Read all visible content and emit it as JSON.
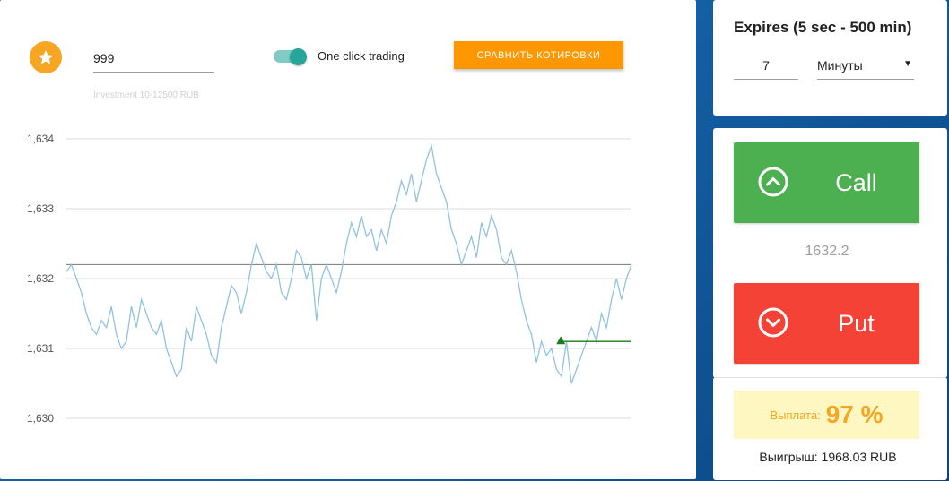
{
  "controls": {
    "investment_value": "999",
    "investment_hint": "Investment 10-12500 RUB",
    "one_click_label": "One click trading",
    "one_click_enabled": true,
    "compare_button_label": "СРАВНИТЬ КОТИРОВКИ"
  },
  "expires": {
    "title": "Expires (5 sec - 500 min)",
    "value": "7",
    "unit": "Минуты"
  },
  "trade": {
    "call_label": "Call",
    "put_label": "Put",
    "current_price": "1632.2"
  },
  "payout": {
    "label": "Выплата:",
    "value": "97 %",
    "win_text": "Выигрыш: 1968.03 RUB"
  },
  "colors": {
    "accent_orange": "#ff9800",
    "call_green": "#4caf50",
    "put_red": "#f44336",
    "toggle_teal": "#26a69a",
    "price_line": "#90c2e2",
    "entry_marker": "#1b7a1b",
    "payout_gold": "#f5a623"
  },
  "chart_data": {
    "type": "line",
    "y_ticks": [
      "1,634",
      "1,633",
      "1,632",
      "1,631",
      "1,630"
    ],
    "ylim": [
      1.63,
      1.634
    ],
    "reference_level": 1.6322,
    "entry_level": 1.6311,
    "entry_marker_x": 0.875,
    "series": [
      {
        "values": [
          1.6321,
          1.6322,
          1.632,
          1.6318,
          1.6315,
          1.6313,
          1.6312,
          1.6314,
          1.6313,
          1.6316,
          1.6312,
          1.631,
          1.6311,
          1.6316,
          1.6313,
          1.6317,
          1.6315,
          1.6313,
          1.6312,
          1.6314,
          1.631,
          1.6308,
          1.6306,
          1.6307,
          1.6313,
          1.6311,
          1.6316,
          1.6314,
          1.6312,
          1.6309,
          1.6308,
          1.6313,
          1.6316,
          1.6319,
          1.6318,
          1.6315,
          1.6318,
          1.6322,
          1.6325,
          1.6323,
          1.6321,
          1.632,
          1.6322,
          1.6318,
          1.6317,
          1.632,
          1.6324,
          1.6323,
          1.632,
          1.6322,
          1.6314,
          1.632,
          1.6322,
          1.632,
          1.6318,
          1.6321,
          1.6325,
          1.6328,
          1.6326,
          1.6329,
          1.6326,
          1.6327,
          1.6324,
          1.6327,
          1.6325,
          1.6329,
          1.6331,
          1.6334,
          1.6332,
          1.6335,
          1.6331,
          1.6334,
          1.6337,
          1.6339,
          1.6335,
          1.6333,
          1.6331,
          1.6327,
          1.6325,
          1.6322,
          1.6324,
          1.6326,
          1.6323,
          1.6328,
          1.6326,
          1.6329,
          1.6327,
          1.6323,
          1.6322,
          1.6324,
          1.6321,
          1.6317,
          1.6314,
          1.6312,
          1.6308,
          1.6311,
          1.6309,
          1.631,
          1.6307,
          1.6306,
          1.6311,
          1.6305,
          1.6307,
          1.6309,
          1.6311,
          1.6313,
          1.6311,
          1.6315,
          1.6313,
          1.6317,
          1.632,
          1.6317,
          1.632,
          1.6322
        ]
      }
    ]
  }
}
